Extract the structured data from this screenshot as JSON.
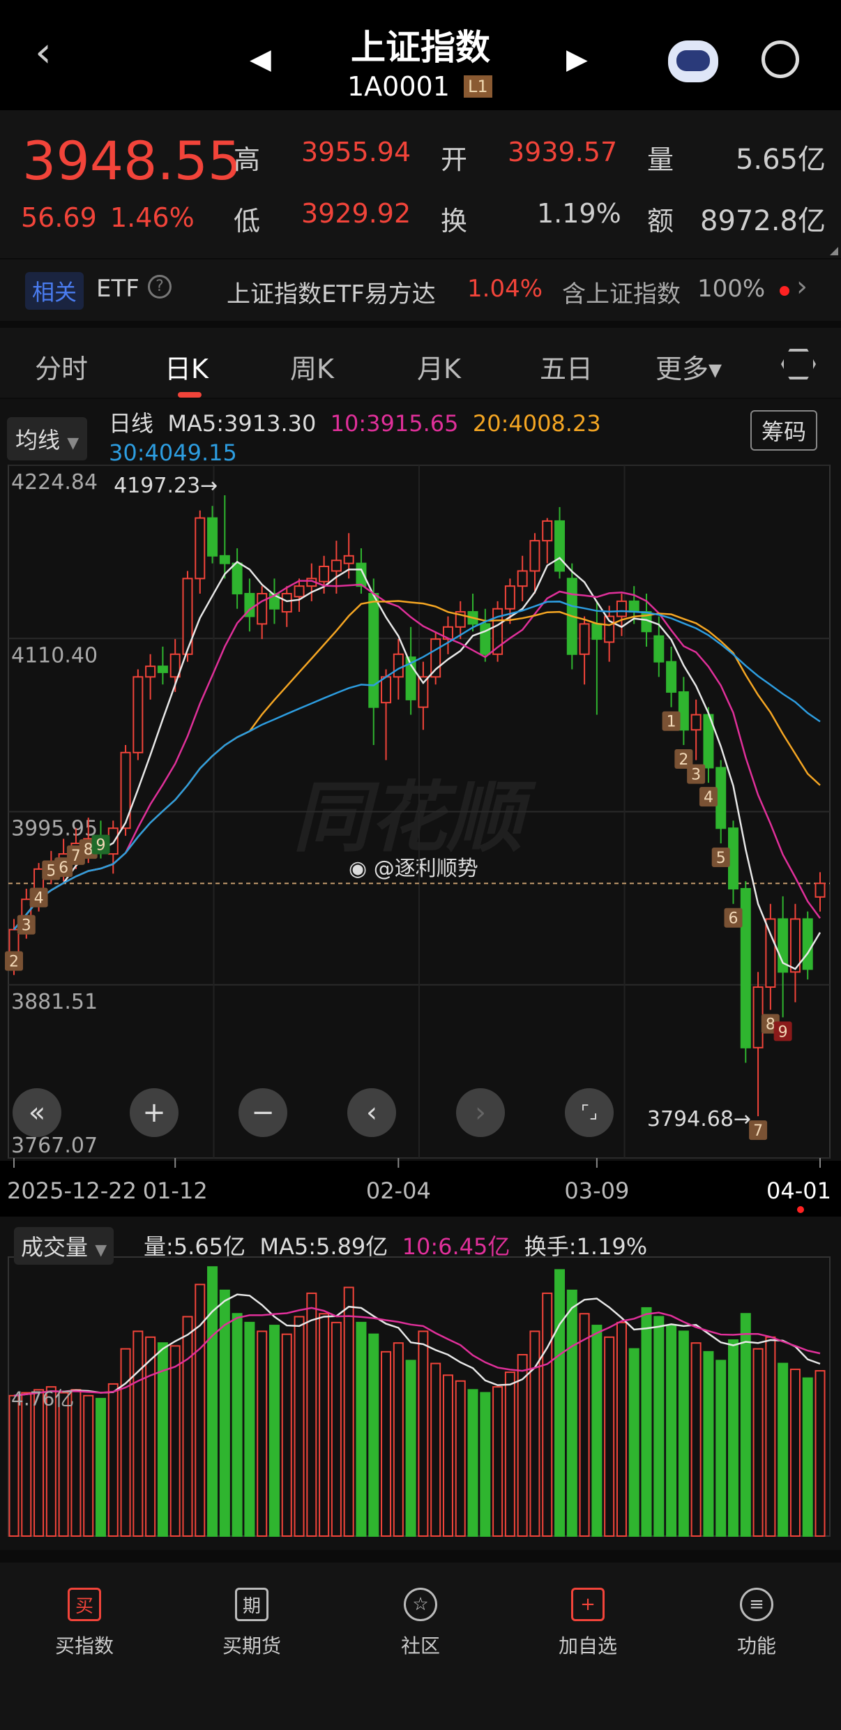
{
  "header": {
    "title": "上证指数",
    "code": "1A0001",
    "level": "L1"
  },
  "quote": {
    "price": "3948.55",
    "change": "56.69",
    "change_pct": "1.46%",
    "high_label": "高",
    "high": "3955.94",
    "low_label": "低",
    "low": "3929.92",
    "open_label": "开",
    "open": "3939.57",
    "turnover_label": "换",
    "turnover": "1.19%",
    "volume_label": "量",
    "volume": "5.65亿",
    "amount_label": "额",
    "amount": "8972.8亿"
  },
  "etf": {
    "badge": "相关",
    "etf_label": "ETF",
    "name": "上证指数ETF易方达",
    "pct": "1.04%",
    "contains": "含上证指数",
    "weight": "100%"
  },
  "tabs": [
    {
      "label": "分时"
    },
    {
      "label": "日K"
    },
    {
      "label": "周K"
    },
    {
      "label": "月K"
    },
    {
      "label": "五日"
    },
    {
      "label": "更多▾"
    }
  ],
  "legend": {
    "selector": "均线",
    "period": "日线",
    "ma5": "MA5:3913.30",
    "ma10": "10:3915.65",
    "ma20": "20:4008.23",
    "ma30": "30:4049.15",
    "chips": "筹码"
  },
  "colors": {
    "up": "#f2443a",
    "down": "#2fb52f",
    "ma5": "#e8e8e8",
    "ma10": "#e0309a",
    "ma20": "#f5a623",
    "ma30": "#2d9de0"
  },
  "watermark": "同花顺",
  "weibo": "@逐利顺势",
  "chart_data": {
    "type": "candlestick",
    "y_ticks": [
      "4224.84",
      "4110.40",
      "3995.95",
      "3881.51",
      "3767.07"
    ],
    "ylim": [
      3767.07,
      4224.84
    ],
    "high_annotation": "4197.23→",
    "low_annotation": "3794.68→",
    "x_ticks": [
      {
        "index": 0,
        "label": "2025-12-22"
      },
      {
        "index": 13,
        "label": "01-12"
      },
      {
        "index": 31,
        "label": "02-04"
      },
      {
        "index": 47,
        "label": "03-09"
      },
      {
        "index": 65,
        "label": "04-01"
      }
    ],
    "current_price": 3948.55,
    "ohlc": [
      [
        3898,
        3925,
        3888,
        3918
      ],
      [
        3918,
        3945,
        3912,
        3938
      ],
      [
        3935,
        3962,
        3930,
        3958
      ],
      [
        3955,
        3970,
        3948,
        3962
      ],
      [
        3960,
        3978,
        3950,
        3968
      ],
      [
        3965,
        3985,
        3958,
        3975
      ],
      [
        3972,
        3992,
        3962,
        3978
      ],
      [
        3978,
        3990,
        3965,
        3970
      ],
      [
        3968,
        3990,
        3955,
        3985
      ],
      [
        3985,
        4040,
        3980,
        4035
      ],
      [
        4035,
        4090,
        4030,
        4085
      ],
      [
        4085,
        4100,
        4070,
        4092
      ],
      [
        4092,
        4105,
        4080,
        4088
      ],
      [
        4085,
        4110,
        4075,
        4100
      ],
      [
        4100,
        4155,
        4095,
        4150
      ],
      [
        4150,
        4195,
        4140,
        4190
      ],
      [
        4190,
        4198,
        4160,
        4165
      ],
      [
        4165,
        4205,
        4150,
        4160
      ],
      [
        4160,
        4170,
        4130,
        4140
      ],
      [
        4140,
        4150,
        4115,
        4125
      ],
      [
        4120,
        4145,
        4110,
        4140
      ],
      [
        4140,
        4150,
        4120,
        4130
      ],
      [
        4128,
        4145,
        4118,
        4140
      ],
      [
        4138,
        4150,
        4128,
        4145
      ],
      [
        4145,
        4160,
        4135,
        4150
      ],
      [
        4148,
        4165,
        4140,
        4158
      ],
      [
        4155,
        4175,
        4140,
        4162
      ],
      [
        4160,
        4180,
        4150,
        4165
      ],
      [
        4160,
        4170,
        4140,
        4145
      ],
      [
        4140,
        4150,
        4040,
        4065
      ],
      [
        4068,
        4090,
        4030,
        4085
      ],
      [
        4085,
        4110,
        4070,
        4100
      ],
      [
        4098,
        4118,
        4060,
        4070
      ],
      [
        4065,
        4095,
        4050,
        4085
      ],
      [
        4085,
        4115,
        4080,
        4110
      ],
      [
        4110,
        4125,
        4100,
        4118
      ],
      [
        4118,
        4135,
        4110,
        4128
      ],
      [
        4128,
        4140,
        4115,
        4120
      ],
      [
        4120,
        4130,
        4095,
        4100
      ],
      [
        4100,
        4135,
        4095,
        4130
      ],
      [
        4130,
        4150,
        4120,
        4145
      ],
      [
        4145,
        4165,
        4135,
        4155
      ],
      [
        4155,
        4180,
        4140,
        4175
      ],
      [
        4175,
        4190,
        4160,
        4188
      ],
      [
        4188,
        4197.23,
        4150,
        4155
      ],
      [
        4150,
        4160,
        4090,
        4100
      ],
      [
        4100,
        4125,
        4080,
        4120
      ],
      [
        4120,
        4135,
        4060,
        4110
      ],
      [
        4108,
        4132,
        4095,
        4125
      ],
      [
        4125,
        4140,
        4112,
        4135
      ],
      [
        4135,
        4145,
        4120,
        4128
      ],
      [
        4128,
        4140,
        4105,
        4115
      ],
      [
        4112,
        4125,
        4085,
        4095
      ],
      [
        4095,
        4105,
        4065,
        4075
      ],
      [
        4075,
        4085,
        4040,
        4050
      ],
      [
        4050,
        4070,
        4030,
        4060
      ],
      [
        4060,
        4065,
        4015,
        4025
      ],
      [
        4025,
        4030,
        3975,
        3985
      ],
      [
        3985,
        3990,
        3935,
        3945
      ],
      [
        3945,
        3950,
        3830,
        3840
      ],
      [
        3840,
        3890,
        3794.68,
        3880
      ],
      [
        3880,
        3935,
        3865,
        3925
      ],
      [
        3925,
        3940,
        3860,
        3890
      ],
      [
        3890,
        3935,
        3870,
        3925
      ],
      [
        3925,
        3930,
        3885,
        3891.86
      ],
      [
        3939.57,
        3955.94,
        3929.92,
        3948.55
      ]
    ],
    "td_marks": [
      {
        "index": 0,
        "label": "2"
      },
      {
        "index": 1,
        "label": "3"
      },
      {
        "index": 2,
        "label": "4"
      },
      {
        "index": 3,
        "label": "5"
      },
      {
        "index": 4,
        "label": "6"
      },
      {
        "index": 5,
        "label": "7"
      },
      {
        "index": 6,
        "label": "8"
      },
      {
        "index": 7,
        "label": "9"
      },
      {
        "index": 53,
        "label": "1"
      },
      {
        "index": 54,
        "label": "2"
      },
      {
        "index": 55,
        "label": "3"
      },
      {
        "index": 56,
        "label": "4"
      },
      {
        "index": 57,
        "label": "5"
      },
      {
        "index": 58,
        "label": "6"
      },
      {
        "index": 60,
        "label": "7"
      },
      {
        "index": 61,
        "label": "8"
      },
      {
        "index": 62,
        "label": "9"
      }
    ],
    "volume": {
      "selector": "成交量",
      "vol": "量:5.65亿",
      "ma5": "MA5:5.89亿",
      "ma10": "10:6.45亿",
      "turnover": "换手:1.19%",
      "axis_label": "4.76亿",
      "ymax": 9.3,
      "values": [
        4.8,
        4.9,
        5.0,
        5.1,
        4.9,
        5.0,
        4.8,
        4.7,
        5.2,
        6.4,
        7.0,
        6.8,
        6.6,
        6.5,
        7.5,
        8.6,
        9.2,
        8.4,
        7.6,
        7.3,
        7.0,
        7.2,
        6.9,
        7.5,
        8.3,
        7.6,
        7.3,
        8.5,
        7.3,
        6.9,
        6.3,
        6.6,
        6.0,
        7.0,
        5.9,
        5.5,
        5.3,
        5.0,
        4.9,
        5.1,
        5.6,
        6.2,
        7.0,
        8.3,
        9.1,
        8.4,
        7.6,
        7.2,
        6.8,
        7.3,
        6.4,
        7.8,
        7.5,
        7.2,
        7.0,
        6.6,
        6.3,
        6.0,
        6.7,
        7.6,
        6.4,
        6.8,
        5.9,
        5.7,
        5.4,
        5.65
      ]
    }
  },
  "overlay_buttons": [
    "«",
    "+",
    "−",
    "‹",
    "›",
    "⌜⌟"
  ],
  "nav": [
    {
      "label": "买指数",
      "icon": "买"
    },
    {
      "label": "买期货",
      "icon": "期"
    },
    {
      "label": "社区",
      "icon": "☆"
    },
    {
      "label": "加自选",
      "icon": "+"
    },
    {
      "label": "功能",
      "icon": "≡"
    }
  ]
}
